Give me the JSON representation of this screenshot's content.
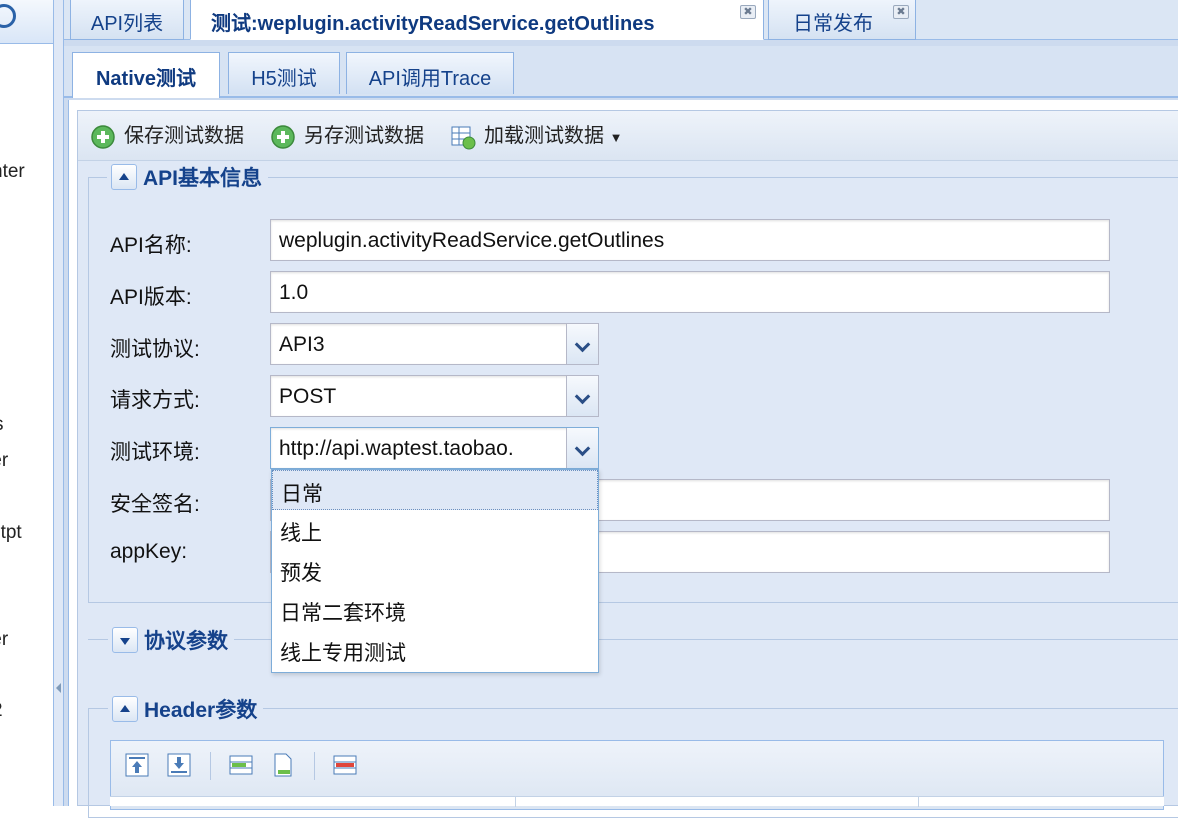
{
  "left_panel": {
    "fragments": [
      "nter",
      "s",
      "ter",
      "etpt",
      "ter",
      "2"
    ]
  },
  "tabs": [
    {
      "label": "API列表",
      "active": false,
      "closable": false
    },
    {
      "label": "测试:weplugin.activityReadService.getOutlines",
      "active": true,
      "closable": true
    },
    {
      "label": "日常发布",
      "active": false,
      "closable": true
    }
  ],
  "sub_tabs": [
    {
      "label": "Native测试",
      "active": true
    },
    {
      "label": "H5测试",
      "active": false
    },
    {
      "label": "API调用Trace",
      "active": false
    }
  ],
  "toolbar": {
    "save": "保存测试数据",
    "save_as": "另存测试数据",
    "load": "加载测试数据"
  },
  "basic_info": {
    "legend": "API基本信息",
    "api_name_label": "API名称:",
    "api_name_value": "weplugin.activityReadService.getOutlines",
    "api_version_label": "API版本:",
    "api_version_value": "1.0",
    "protocol_label": "测试协议:",
    "protocol_value": "API3",
    "method_label": "请求方式:",
    "method_value": "POST",
    "env_label": "测试环境:",
    "env_value": "http://api.waptest.taobao.",
    "sign_label": "安全签名:",
    "appkey_label": "appKey:"
  },
  "env_options": [
    "日常",
    "线上",
    "预发",
    "日常二套环境",
    "线上专用测试"
  ],
  "protocol_params": {
    "legend": "协议参数"
  },
  "header_params": {
    "legend": "Header参数"
  },
  "colors": {
    "accent": "#15428b",
    "border": "#99bbe8",
    "panel_bg": "#dfe8f6"
  }
}
